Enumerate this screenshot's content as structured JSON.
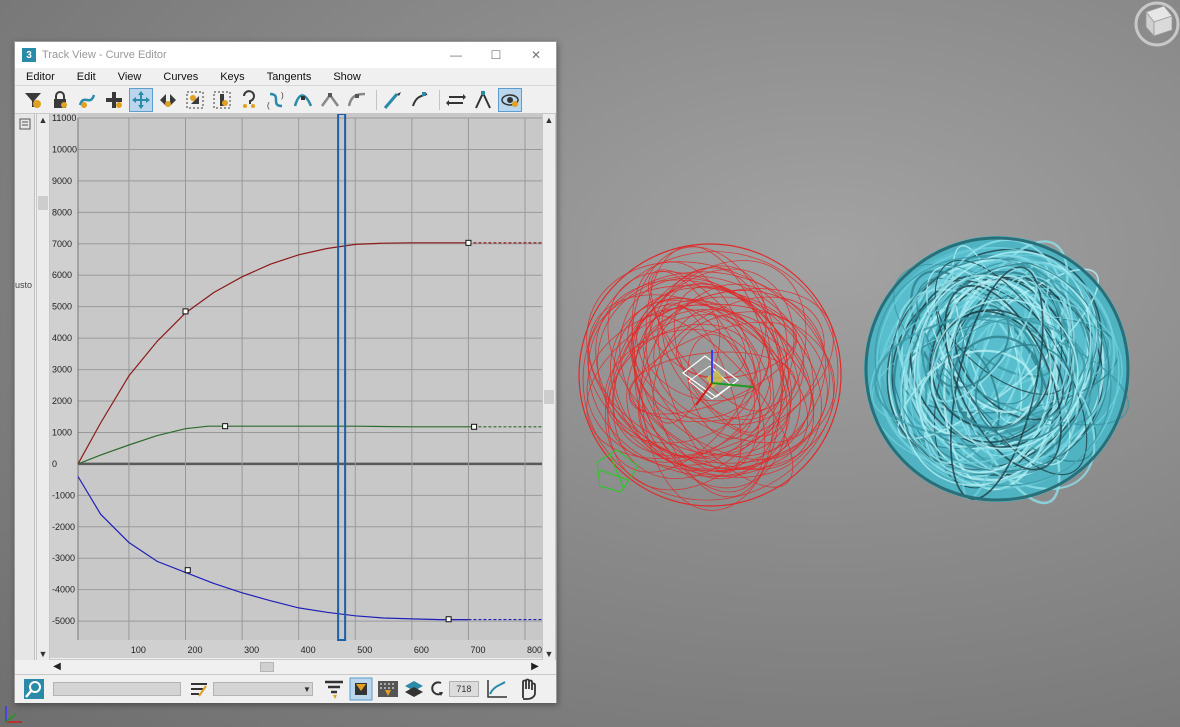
{
  "window": {
    "app_icon": "3",
    "title": "Track View - Curve Editor",
    "buttons": {
      "minimize": "—",
      "maximize": "☐",
      "close": "✕"
    }
  },
  "menu": [
    "Editor",
    "Edit",
    "View",
    "Curves",
    "Keys",
    "Tangents",
    "Show"
  ],
  "toolbar_icons": [
    "filter-icon",
    "lock-selection-icon",
    "snap-icon",
    "add-key-icon",
    "move-key-icon",
    "slide-key-icon",
    "scale-keys-icon",
    "scale-values-icon",
    "parameter-curve-oot-icon",
    "ease-curve-icon",
    "tangent-auto-icon",
    "tangent-spline-icon",
    "tangent-fast-icon",
    "draw-curve-icon",
    "reduce-keys-icon",
    "breakdown-icon",
    "show-tangents-icon",
    "lock-tangents-icon",
    "show-buffer-icon"
  ],
  "left_panel_label": "usto",
  "status": {
    "frame_value": "718"
  },
  "chart_data": {
    "type": "line",
    "x_tick_labels": [
      "100",
      "200",
      "300",
      "400",
      "500",
      "600",
      "700",
      "800"
    ],
    "y_tick_labels": [
      "11000",
      "10000",
      "9000",
      "8000",
      "7000",
      "6000",
      "5000",
      "4000",
      "3000",
      "2000",
      "1000",
      "0",
      "-1000",
      "-2000",
      "-3000",
      "-4000",
      "-5000"
    ],
    "xlim": [
      10,
      830
    ],
    "ylim": [
      -5600,
      11000
    ],
    "current_frame": 475,
    "series": [
      {
        "color": "#8b1a1a",
        "points": [
          [
            10,
            0
          ],
          [
            50,
            1300
          ],
          [
            100,
            2800
          ],
          [
            150,
            3900
          ],
          [
            200,
            4800
          ],
          [
            250,
            5450
          ],
          [
            300,
            5950
          ],
          [
            350,
            6350
          ],
          [
            400,
            6650
          ],
          [
            450,
            6850
          ],
          [
            500,
            6980
          ],
          [
            550,
            7020
          ],
          [
            600,
            7030
          ],
          [
            650,
            7030
          ],
          [
            700,
            7030
          ]
        ],
        "keys": [
          [
            200,
            4850
          ],
          [
            700,
            7030
          ]
        ],
        "extrapolate_to": 830
      },
      {
        "color": "#2d6b2d",
        "points": [
          [
            10,
            0
          ],
          [
            50,
            280
          ],
          [
            100,
            600
          ],
          [
            150,
            900
          ],
          [
            200,
            1120
          ],
          [
            240,
            1200
          ],
          [
            300,
            1200
          ],
          [
            400,
            1200
          ],
          [
            500,
            1200
          ],
          [
            600,
            1180
          ],
          [
            700,
            1180
          ]
        ],
        "keys": [
          [
            270,
            1200
          ],
          [
            710,
            1180
          ]
        ],
        "extrapolate_to": 830
      },
      {
        "color": "#2020b8",
        "points": [
          [
            10,
            -400
          ],
          [
            50,
            -1600
          ],
          [
            100,
            -2500
          ],
          [
            150,
            -3100
          ],
          [
            200,
            -3450
          ],
          [
            250,
            -3800
          ],
          [
            300,
            -4100
          ],
          [
            350,
            -4350
          ],
          [
            400,
            -4580
          ],
          [
            450,
            -4720
          ],
          [
            500,
            -4830
          ],
          [
            550,
            -4900
          ],
          [
            600,
            -4930
          ],
          [
            650,
            -4950
          ],
          [
            700,
            -4950
          ]
        ],
        "keys": [
          [
            204,
            -3380
          ],
          [
            665,
            -4940
          ]
        ],
        "extrapolate_to": 830
      }
    ]
  }
}
